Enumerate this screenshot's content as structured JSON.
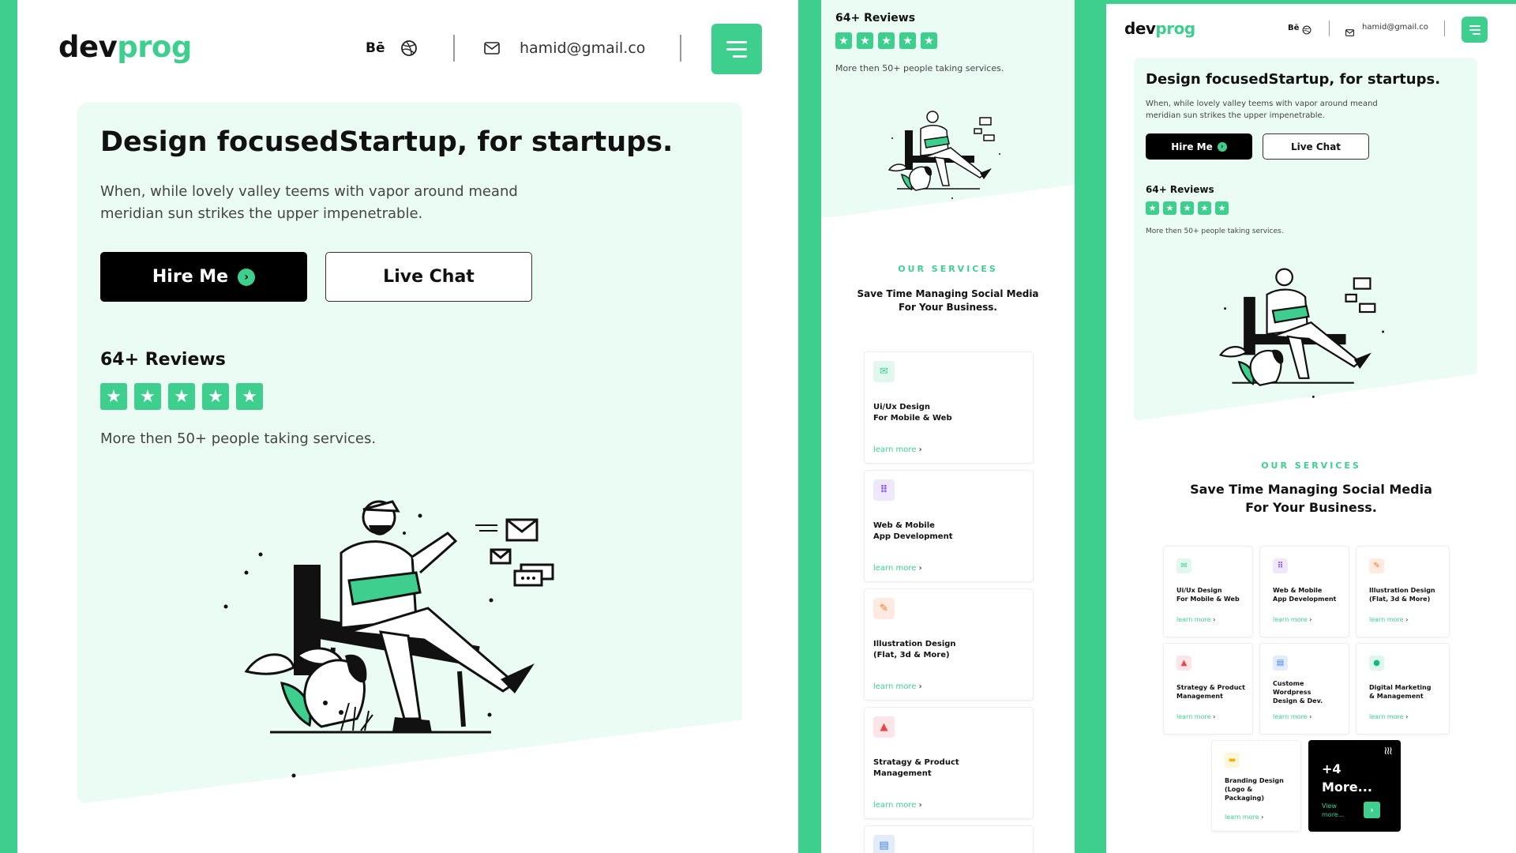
{
  "brand": {
    "logo_part1": "dev",
    "logo_part2": "prog",
    "accent": "#3ecf8e",
    "hero_bg": "#eafcf4"
  },
  "header": {
    "behance_label": "Bē",
    "dribbble_icon": "dribbble-icon",
    "mail_icon": "mail-icon",
    "email": "hamid@gmail.co",
    "menu_icon": "hamburger-menu-icon"
  },
  "hero": {
    "title": "Design focusedStartup, for startups.",
    "subtitle": "When, while lovely valley teems with vapor around meand meridian sun strikes the upper impenetrable.",
    "hire_label": "Hire Me",
    "chat_label": "Live Chat",
    "reviews_label": "64+ Reviews",
    "rating": 5,
    "reviews_note": "More then 50+ people taking services."
  },
  "services": {
    "kicker": "OUR SERVICES",
    "heading_line1": "Save Time Managing Social Media",
    "heading_line2": "For Your Business.",
    "link_label": "learn more",
    "items": [
      {
        "line1": "Ui/Ux Design",
        "line2": "For Mobile & Web",
        "icon": "mail-icon",
        "color": "#3ecf8e",
        "bg": "#e2f8ee"
      },
      {
        "line1": "Web & Mobile",
        "line2": "App Development",
        "icon": "grid-icon",
        "color": "#8b5cf6",
        "bg": "#efe8fd"
      },
      {
        "line1": "Illustration Design",
        "line2": "(Flat, 3d & More)",
        "icon": "pen-tool-icon",
        "color": "#f97316",
        "bg": "#feeae1"
      },
      {
        "line1": "Strategy & Product",
        "line2": "Management",
        "icon": "bell-icon",
        "color": "#ef4444",
        "bg": "#fde4e8"
      },
      {
        "line1": "Custome",
        "line2": "Wordpress",
        "line3": "Design & Dev.",
        "icon": "document-icon",
        "color": "#3b82f6",
        "bg": "#e2ecfd"
      },
      {
        "line1": "Digital Marketing",
        "line2": "& Management",
        "icon": "chart-icon",
        "color": "#10b981",
        "bg": "#ddf7ec"
      },
      {
        "line1": "Branding Design",
        "line2": "(Logo &",
        "line3": "Packaging)",
        "icon": "card-icon",
        "color": "#eab308",
        "bg": "#fdf6d8"
      }
    ],
    "mobile_item3_line1": "Stratagy & Product",
    "more_count": "+4",
    "more_label": "More...",
    "more_view": "View",
    "more_view2": "more..."
  }
}
